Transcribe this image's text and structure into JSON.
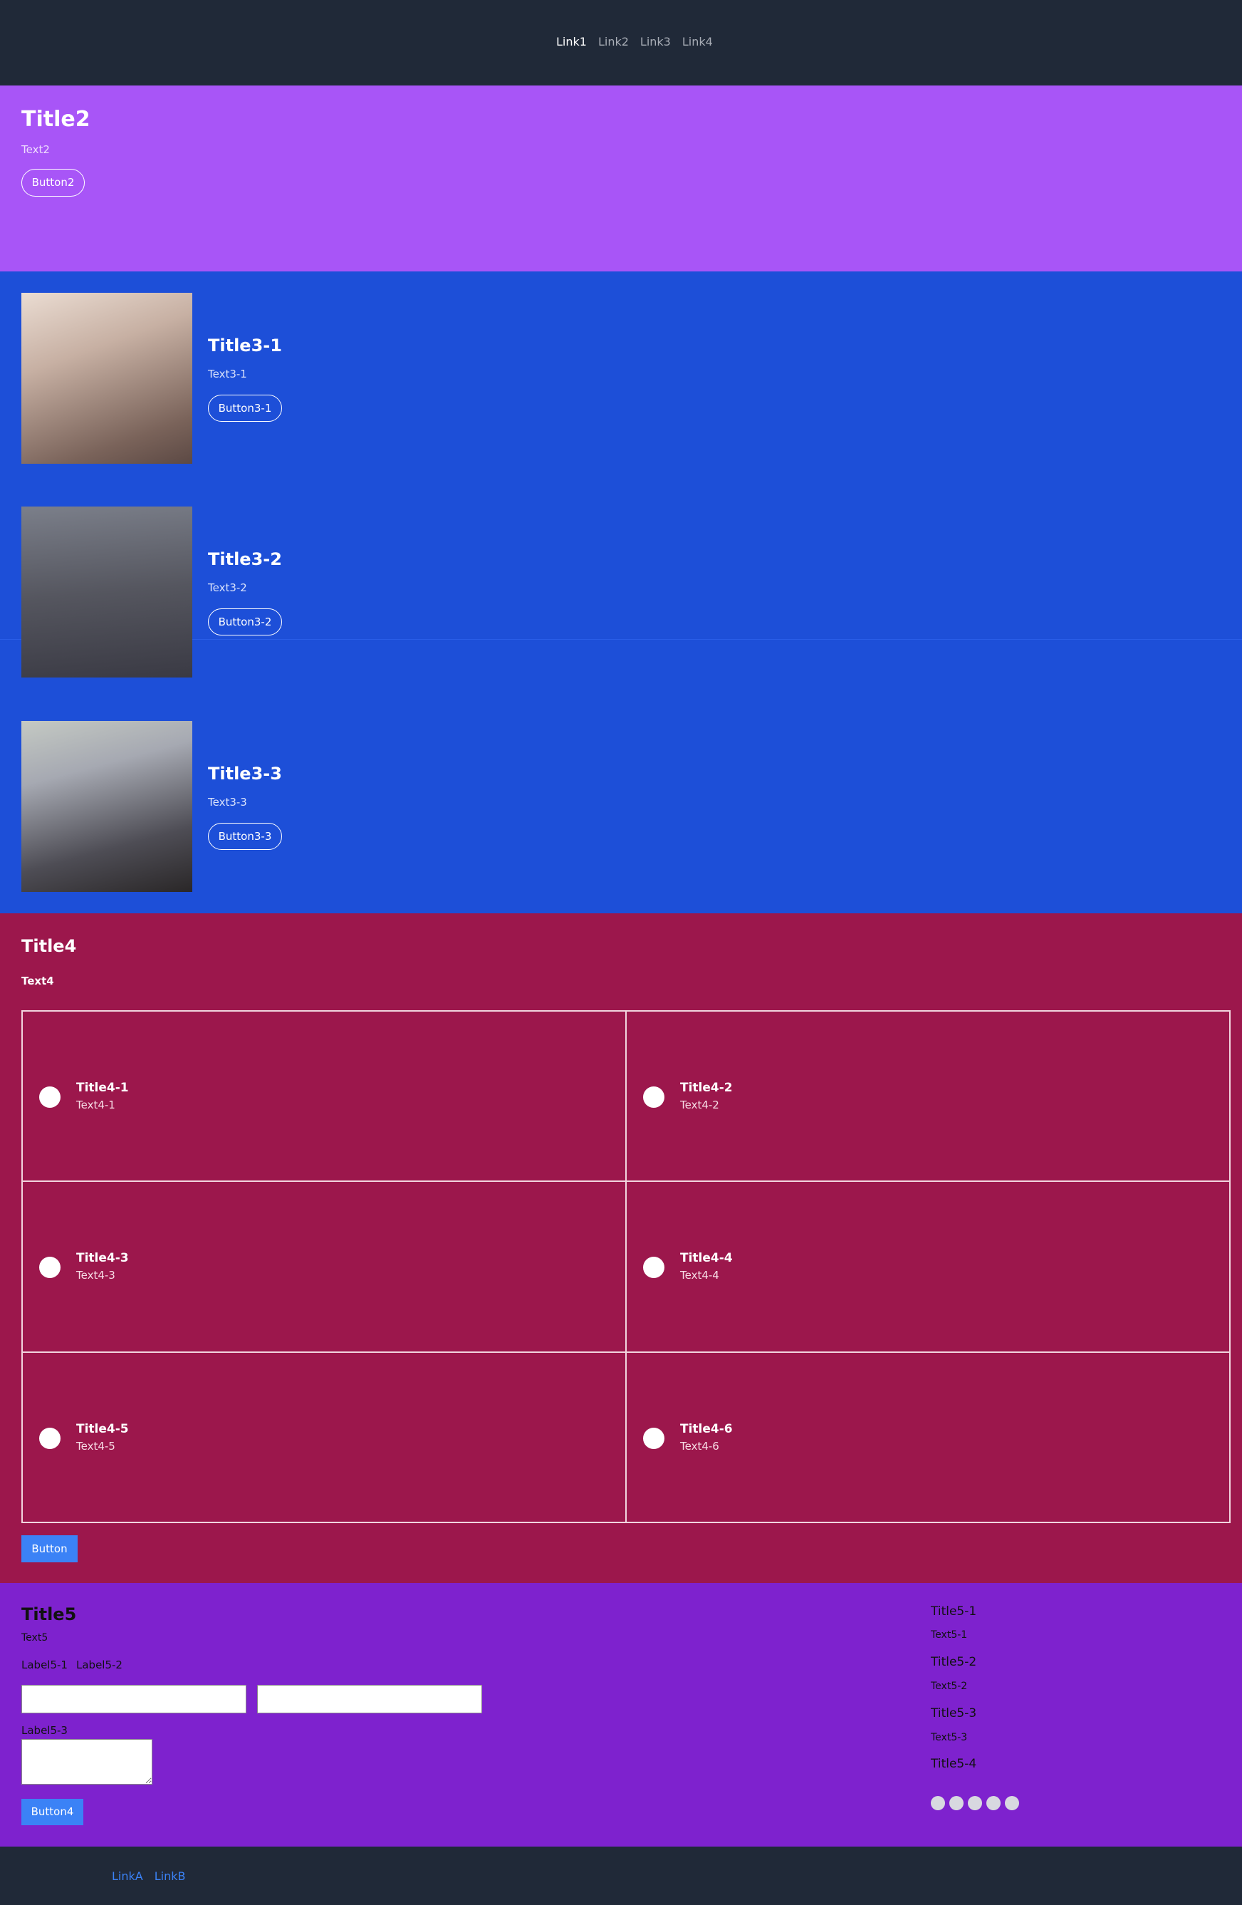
{
  "nav": {
    "links": [
      "Link1",
      "Link2",
      "Link3",
      "Link4"
    ],
    "active_index": 0
  },
  "hero": {
    "title": "Title2",
    "text": "Text2",
    "button": "Button2"
  },
  "features": [
    {
      "title": "Title3-1",
      "text": "Text3-1",
      "button": "Button3-1"
    },
    {
      "title": "Title3-2",
      "text": "Text3-2",
      "button": "Button3-2"
    },
    {
      "title": "Title3-3",
      "text": "Text3-3",
      "button": "Button3-3"
    }
  ],
  "services": {
    "title": "Title4",
    "text": "Text4",
    "items": [
      {
        "title": "Title4-1",
        "text": "Text4-1"
      },
      {
        "title": "Title4-2",
        "text": "Text4-2"
      },
      {
        "title": "Title4-3",
        "text": "Text4-3"
      },
      {
        "title": "Title4-4",
        "text": "Text4-4"
      },
      {
        "title": "Title4-5",
        "text": "Text4-5"
      },
      {
        "title": "Title4-6",
        "text": "Text4-6"
      }
    ],
    "button": "Button"
  },
  "contact": {
    "title": "Title5",
    "text": "Text5",
    "label1": "Label5-1",
    "label2": "Label5-2",
    "label3": "Label5-3",
    "button": "Button4",
    "side": [
      {
        "title": "Title5-1",
        "text": "Text5-1"
      },
      {
        "title": "Title5-2",
        "text": "Text5-2"
      },
      {
        "title": "Title5-3",
        "text": "Text5-3"
      },
      {
        "title": "Title5-4"
      }
    ],
    "social_icons": [
      "social-icon-1",
      "social-icon-2",
      "social-icon-3",
      "social-icon-4",
      "social-icon-5"
    ]
  },
  "footer": {
    "links": [
      "LinkA",
      "LinkB"
    ]
  },
  "colors": {
    "nav_bg": "#202938",
    "hero_bg": "#a855f7",
    "features_bg": "#1d4fd8",
    "services_bg": "#9c174c",
    "contact_bg": "#7e22ce",
    "accent": "#3b82f6"
  }
}
